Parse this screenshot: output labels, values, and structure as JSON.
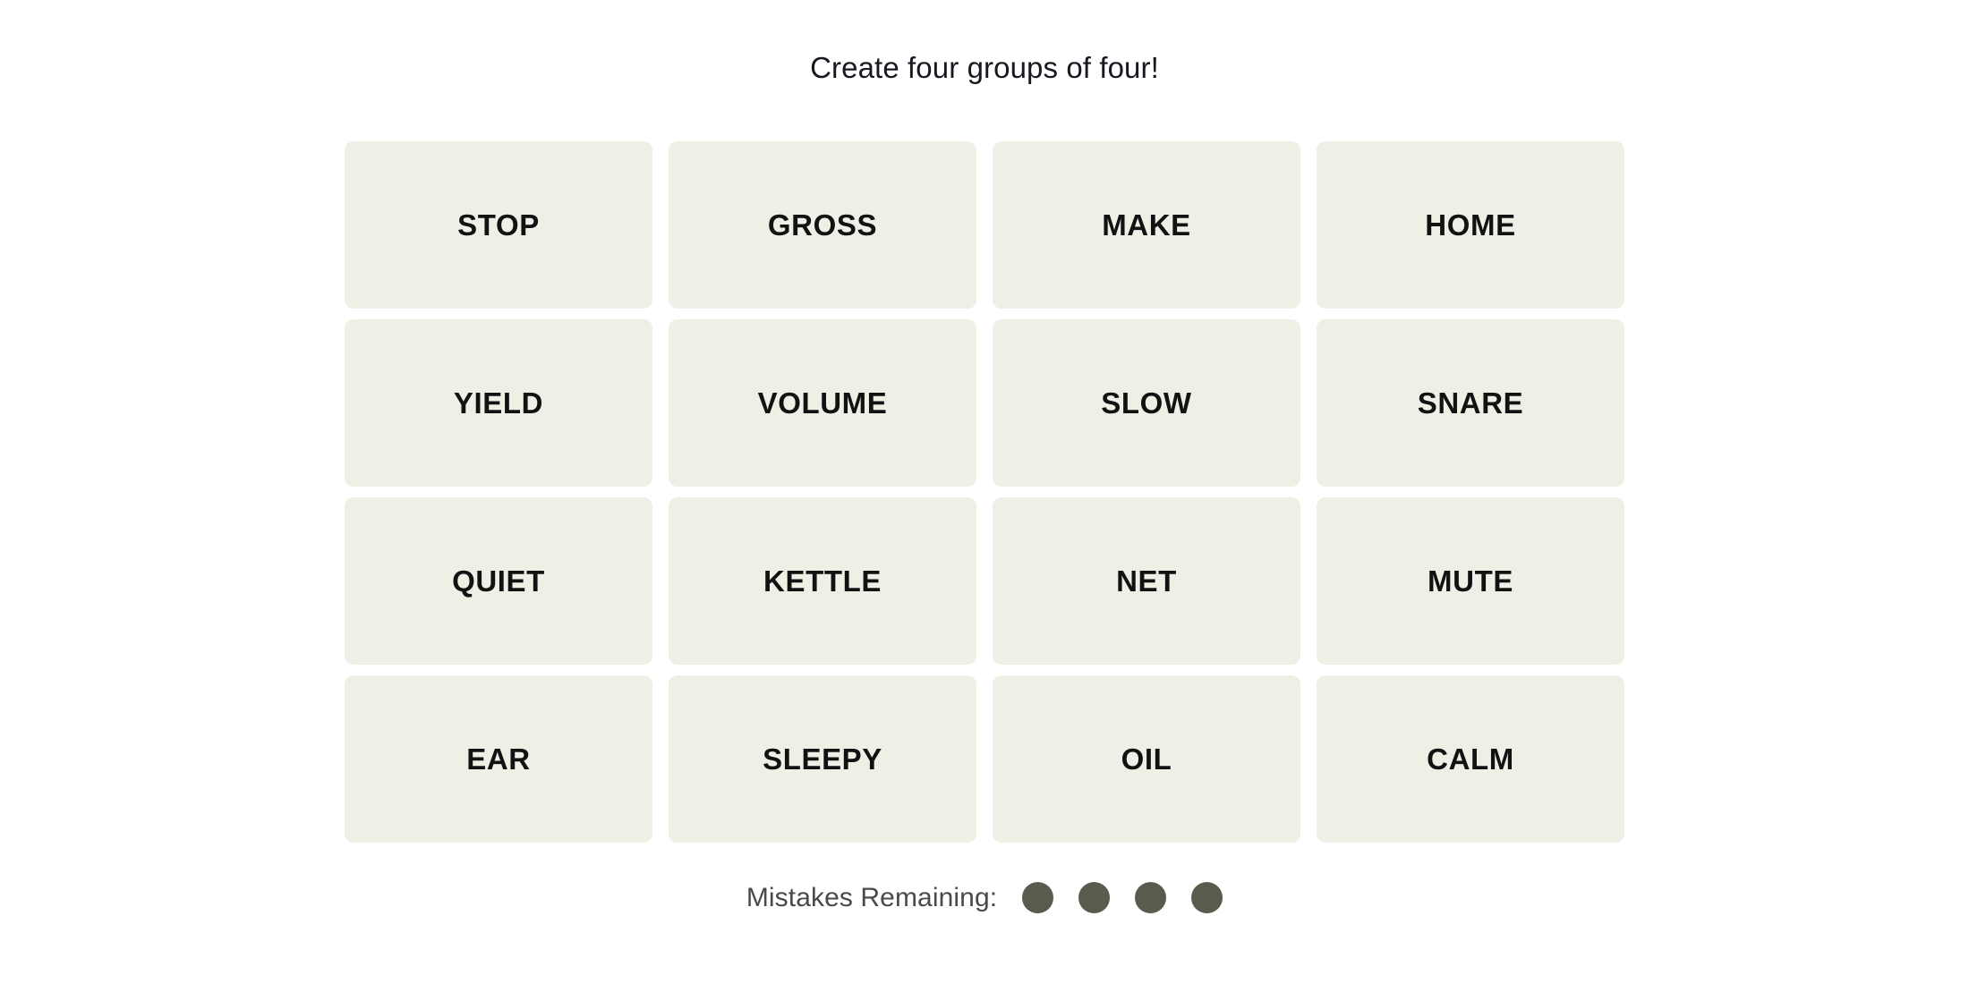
{
  "header": {
    "title": "Create four groups of four!"
  },
  "board": {
    "rows": 4,
    "columns": 4,
    "tiles": [
      {
        "label": "STOP"
      },
      {
        "label": "GROSS"
      },
      {
        "label": "MAKE"
      },
      {
        "label": "HOME"
      },
      {
        "label": "YIELD"
      },
      {
        "label": "VOLUME"
      },
      {
        "label": "SLOW"
      },
      {
        "label": "SNARE"
      },
      {
        "label": "QUIET"
      },
      {
        "label": "KETTLE"
      },
      {
        "label": "NET"
      },
      {
        "label": "MUTE"
      },
      {
        "label": "EAR"
      },
      {
        "label": "SLEEPY"
      },
      {
        "label": "OIL"
      },
      {
        "label": "CALM"
      }
    ]
  },
  "footer": {
    "mistakes_label": "Mistakes Remaining:",
    "mistakes_remaining": 4,
    "dots": [
      {
        "name": "mistake-dot-1",
        "filled": true
      },
      {
        "name": "mistake-dot-2",
        "filled": true
      },
      {
        "name": "mistake-dot-3",
        "filled": true
      },
      {
        "name": "mistake-dot-4",
        "filled": true
      }
    ]
  },
  "colors": {
    "page_background": "#ffffff",
    "tile_background": "#efefe6",
    "tile_text": "#121212",
    "header_text": "#16191f",
    "mistakes_label_text": "#4a4a4a",
    "mistake_dot": "#5a5a4d"
  }
}
